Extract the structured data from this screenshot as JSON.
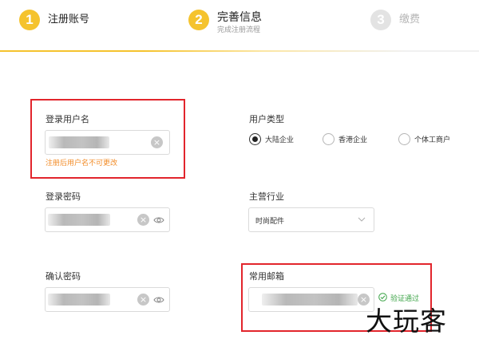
{
  "steps": [
    {
      "number": "1",
      "title": "注册账号",
      "state": "done"
    },
    {
      "number": "2",
      "title": "完善信息",
      "subtitle": "完成注册流程",
      "state": "active"
    },
    {
      "number": "3",
      "title": "缴费",
      "state": "todo"
    }
  ],
  "form": {
    "username": {
      "label": "登录用户名",
      "hint": "注册后用户名不可更改",
      "clear_icon": "×"
    },
    "password": {
      "label": "登录密码",
      "clear_icon": "×"
    },
    "confirm_password": {
      "label": "确认密码",
      "clear_icon": "×"
    },
    "user_type": {
      "label": "用户类型",
      "options": [
        "大陆企业",
        "香港企业",
        "个体工商户"
      ],
      "selected_index": 0
    },
    "industry": {
      "label": "主营行业",
      "value": "时尚配件"
    },
    "email": {
      "label": "常用邮箱",
      "clear_icon": "×",
      "verify_text": "验证通过"
    }
  },
  "watermark": "大玩客",
  "colors": {
    "accent": "#f5c32e",
    "step_inactive": "#e3e3e3",
    "hint": "#f28c28",
    "success": "#3fa54a",
    "highlight": "#e2252c"
  }
}
